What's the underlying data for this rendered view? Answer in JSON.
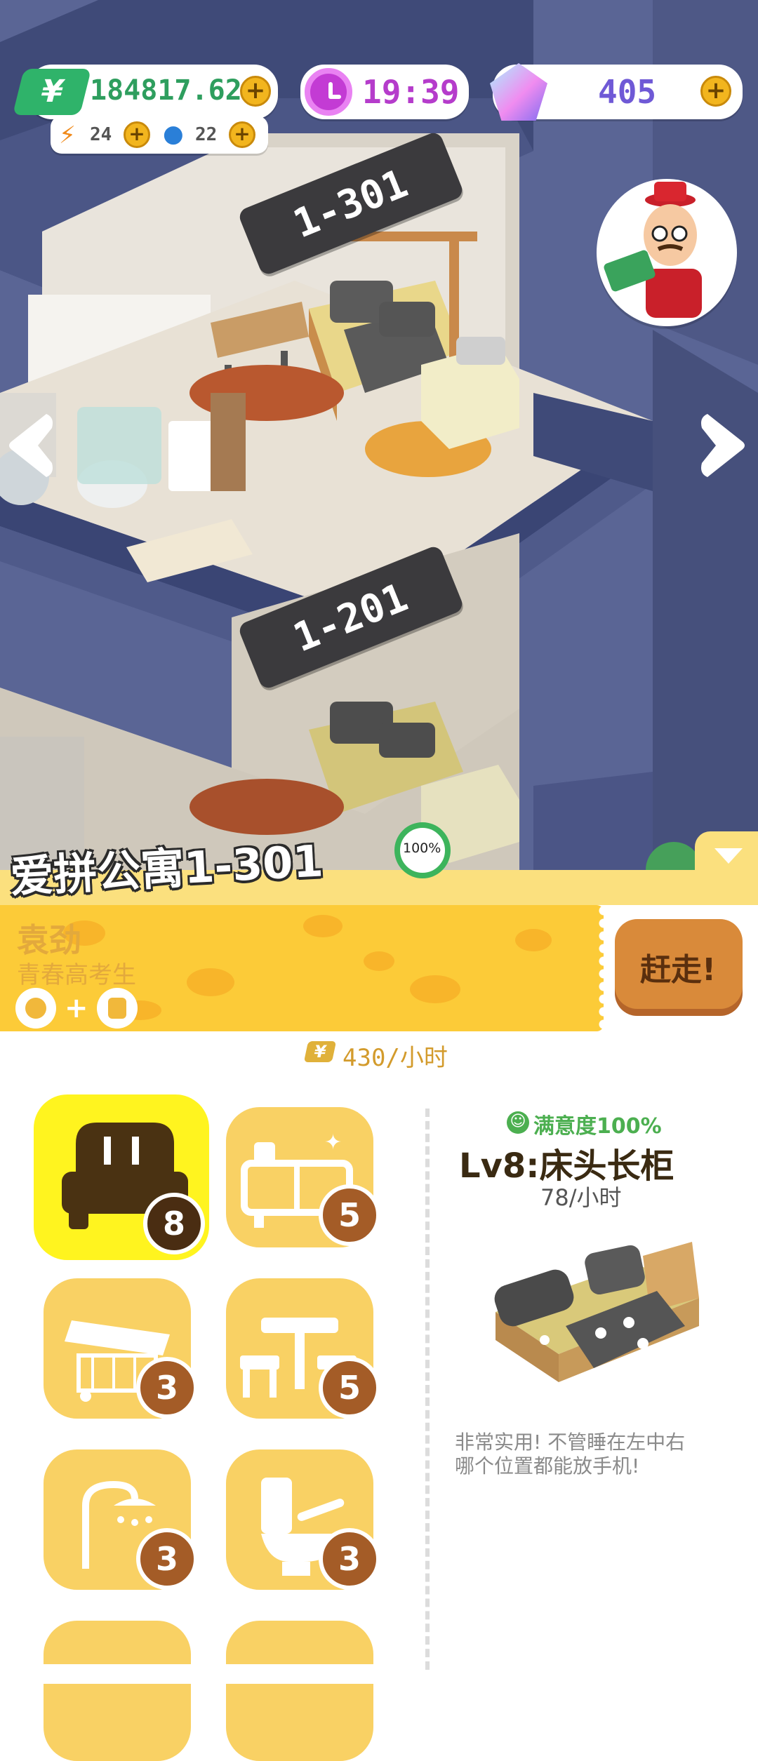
{
  "hud": {
    "money": "184817.62",
    "money_icon": "yuan-icon",
    "energy": "24",
    "water": "22",
    "clock": "19:39",
    "gems": "405"
  },
  "rooms": [
    {
      "label": "1-301"
    },
    {
      "label": "1-201"
    }
  ],
  "apartment": {
    "title": "爱拼公寓1-301",
    "occupancy": "100%"
  },
  "tenant": {
    "name": "袁劲",
    "role": "青春高考生",
    "plus_sign": "+"
  },
  "evict_button": "赶走!",
  "income": "430/小时",
  "categories": [
    {
      "icon": "bed-icon",
      "count": "8",
      "active": true
    },
    {
      "icon": "cabinet-icon",
      "count": "5"
    },
    {
      "icon": "desk-icon",
      "count": "3"
    },
    {
      "icon": "table-chair-icon",
      "count": "5"
    },
    {
      "icon": "shower-icon",
      "count": "3"
    },
    {
      "icon": "toilet-icon",
      "count": "3"
    }
  ],
  "detail": {
    "satisfaction": "满意度100%",
    "item_name": "Lv8:床头长柜",
    "rate": "78/小时",
    "description_line1": "非常实用! 不管睡在左中右",
    "description_line2": "哪个位置都能放手机!"
  },
  "colors": {
    "accent_yellow": "#f9d164",
    "banner_yellow": "#fce48a",
    "button_orange": "#d98a3a",
    "scene_blue": "#55608f",
    "green": "#4caf50"
  }
}
